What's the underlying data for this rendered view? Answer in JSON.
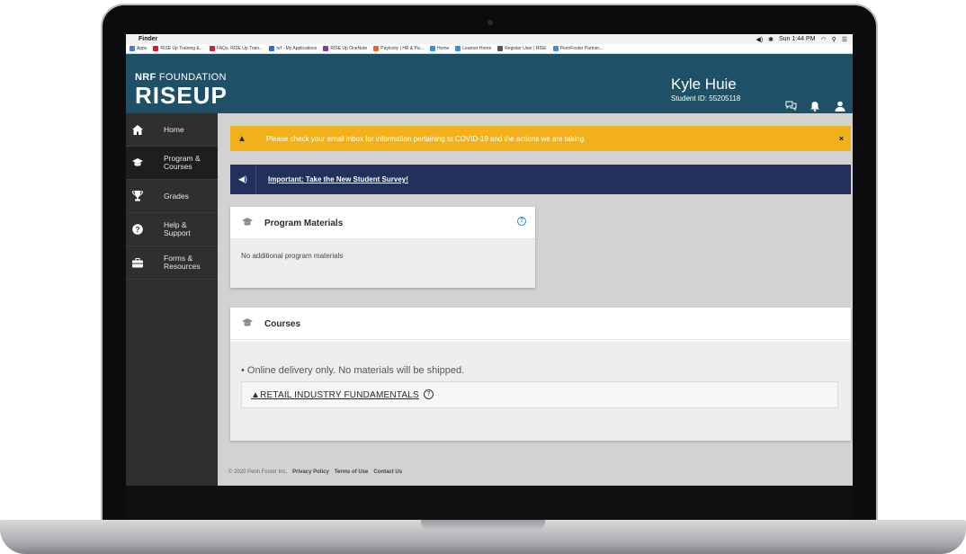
{
  "menubar": {
    "app": "Finder",
    "clock": "Sun 1:44 PM"
  },
  "bookmarks": [
    {
      "label": "Apps",
      "color": "#4a7bd0"
    },
    {
      "label": "RISE Up Training &...",
      "color": "#d0202a"
    },
    {
      "label": "FAQs: RISE Up Train...",
      "color": "#d0202a"
    },
    {
      "label": "nrf - My Applications",
      "color": "#2a6fd6"
    },
    {
      "label": "RISE Up OneNote",
      "color": "#7b3fa0"
    },
    {
      "label": "Paylocity | HR & Pa...",
      "color": "#e86a1e"
    },
    {
      "label": "Home",
      "color": "#3a8fd8"
    },
    {
      "label": "Learner Home",
      "color": "#3a8fd8"
    },
    {
      "label": "Register User | RISE",
      "color": "#555555"
    },
    {
      "label": "PennFoster Partner...",
      "color": "#3a8fd8"
    }
  ],
  "header": {
    "logo_top_bold": "NRF",
    "logo_top": " FOUNDATION",
    "logo_main": "RISEUP",
    "user_name": "Kyle Huie",
    "student_id": "Student ID: 55205118"
  },
  "sidebar": {
    "items": [
      {
        "label": "Home",
        "icon": "home-icon"
      },
      {
        "label": "Program & Courses",
        "icon": "graduation-cap-icon"
      },
      {
        "label": "Grades",
        "icon": "trophy-icon"
      },
      {
        "label": "Help & Support",
        "icon": "question-icon"
      },
      {
        "label": "Forms & Resources",
        "icon": "briefcase-icon"
      }
    ]
  },
  "alerts": {
    "covid": "Please check your email inbox for information pertaining to COVID-19 and the actions we are taking.",
    "close": "×",
    "survey": "Important: Take the New Student Survey!"
  },
  "program_materials": {
    "title": "Program Materials",
    "body": "No additional program materials"
  },
  "courses": {
    "title": "Courses",
    "note": "• Online delivery only. No materials will be shipped.",
    "course_label": "▲RETAIL INDUSTRY FUNDAMENTALS"
  },
  "footer": {
    "copyright": "© 2020 Penn Foster Inc.",
    "links": [
      "Privacy Policy",
      "Terms of Use",
      "Contact Us"
    ]
  },
  "colors": {
    "header": "#1e5168",
    "sidebar": "#2f2f2f",
    "covid_alert": "#f1b11a",
    "survey_alert": "#22305c",
    "help_icon": "#2a8fd6"
  }
}
